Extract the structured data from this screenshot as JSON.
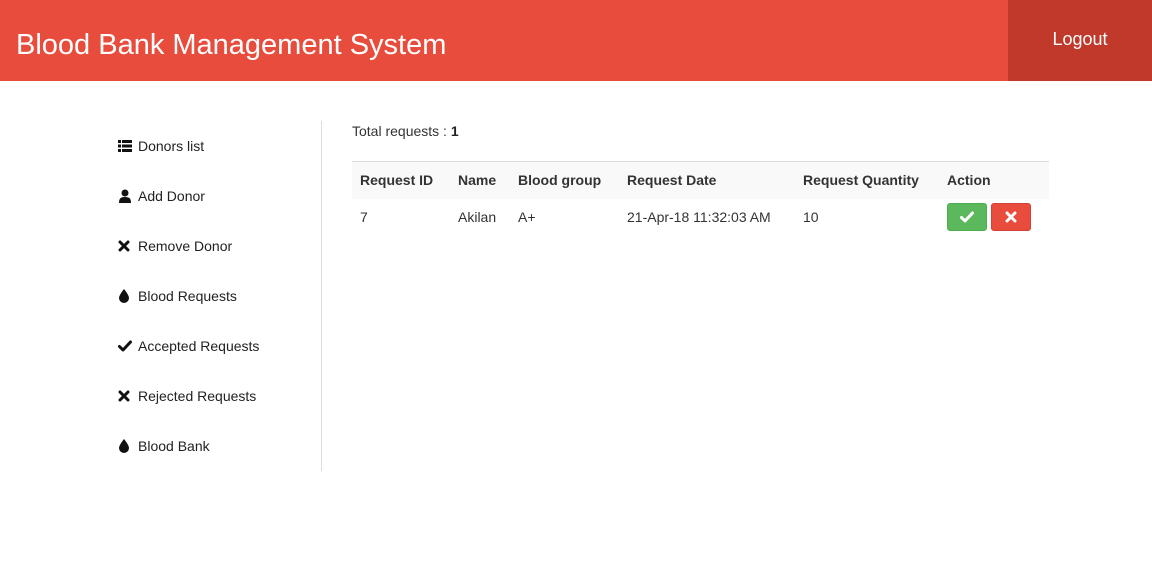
{
  "header": {
    "title": "Blood Bank Management System",
    "logout_label": "Logout",
    "color": "#e74c3c",
    "logout_color": "#c0392b"
  },
  "sidebar": {
    "items": [
      {
        "label": "Donors list",
        "icon": "list-icon"
      },
      {
        "label": "Add Donor",
        "icon": "user-icon"
      },
      {
        "label": "Remove Donor",
        "icon": "close-icon"
      },
      {
        "label": "Blood Requests",
        "icon": "drop-icon"
      },
      {
        "label": "Accepted Requests",
        "icon": "check-icon"
      },
      {
        "label": "Rejected Requests",
        "icon": "close-icon"
      },
      {
        "label": "Blood Bank",
        "icon": "drop-icon"
      }
    ]
  },
  "main": {
    "total_label": "Total requests :",
    "total_count": "1",
    "table": {
      "columns": [
        "Request ID",
        "Name",
        "Blood group",
        "Request Date",
        "Request Quantity",
        "Action"
      ],
      "rows": [
        {
          "id": "7",
          "name": "Akilan",
          "blood_group": "A+",
          "date": "21-Apr-18 11:32:03 AM",
          "quantity": "10",
          "actions": [
            "check-icon",
            "close-icon"
          ]
        }
      ]
    }
  },
  "colors": {
    "accept": "#5cb85c",
    "reject": "#e74c3c"
  }
}
